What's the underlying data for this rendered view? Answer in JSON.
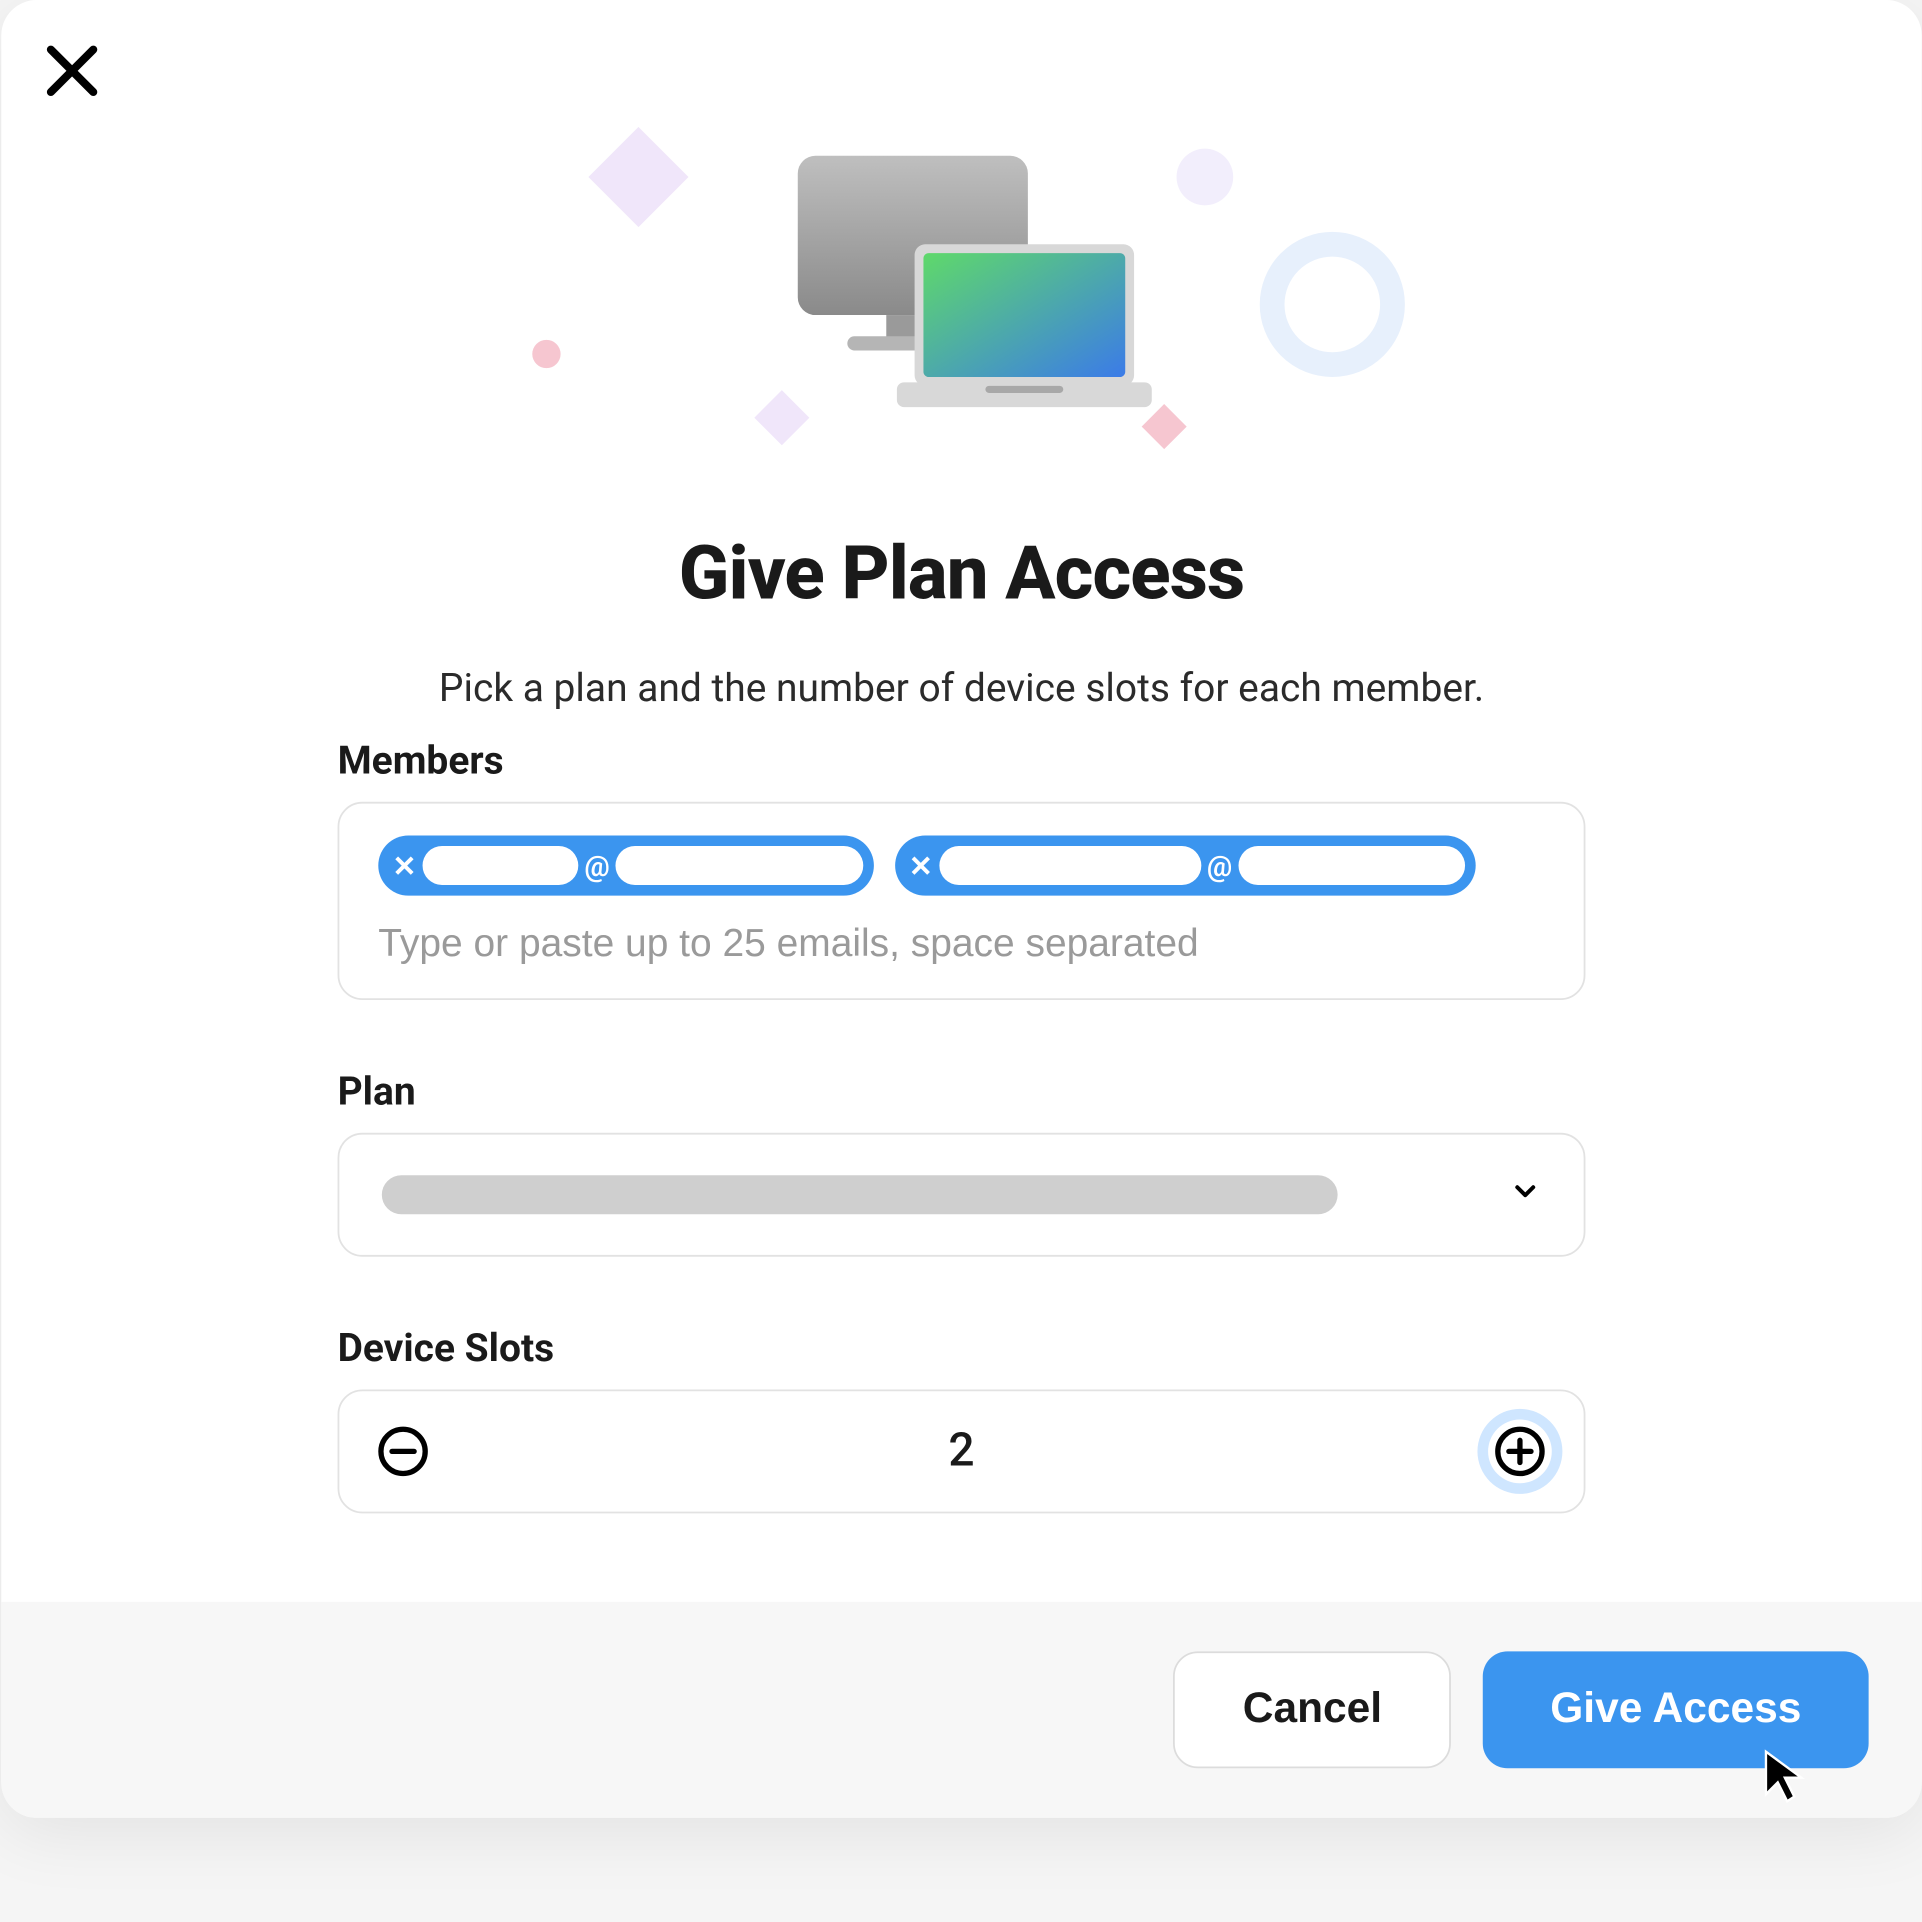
{
  "modal": {
    "title": "Give Plan Access",
    "subtitle": "Pick a plan and the number of device slots for each member.",
    "members": {
      "label": "Members",
      "placeholder": "Type or paste up to 25 emails, space separated",
      "chips": [
        {
          "local_width": 88,
          "domain_width": 140
        },
        {
          "local_width": 148,
          "domain_width": 128
        }
      ]
    },
    "plan": {
      "label": "Plan"
    },
    "device_slots": {
      "label": "Device Slots",
      "value": "2"
    },
    "buttons": {
      "cancel": "Cancel",
      "confirm": "Give Access"
    }
  }
}
